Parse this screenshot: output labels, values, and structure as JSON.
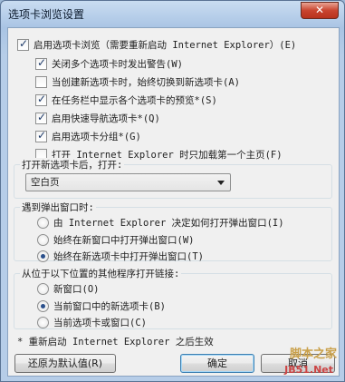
{
  "window": {
    "title": "选项卡浏览设置",
    "close_label": "✕"
  },
  "main_option": {
    "label": "启用选项卡浏览（需要重新启动 Internet Explorer）(E)",
    "checked": true
  },
  "sub_options": [
    {
      "label": "关闭多个选项卡时发出警告(W)",
      "checked": true
    },
    {
      "label": "当创建新选项卡时，始终切换到新选项卡(A)",
      "checked": false
    },
    {
      "label": "在任务栏中显示各个选项卡的预览*(S)",
      "checked": true
    },
    {
      "label": "启用快速导航选项卡*(Q)",
      "checked": true
    },
    {
      "label": "启用选项卡分组*(G)",
      "checked": true
    },
    {
      "label": "打开 Internet Explorer 时只加载第一个主页(F)",
      "checked": false
    }
  ],
  "new_tab": {
    "heading": "打开新选项卡后，打开:",
    "selected": "空白页"
  },
  "popups": {
    "heading": "遇到弹出窗口时:",
    "options": [
      {
        "label": "由 Internet Explorer 决定如何打开弹出窗口(I)",
        "checked": false
      },
      {
        "label": "始终在新窗口中打开弹出窗口(W)",
        "checked": false
      },
      {
        "label": "始终在新选项卡中打开弹出窗口(T)",
        "checked": true
      }
    ]
  },
  "links": {
    "heading": "从位于以下位置的其他程序打开链接:",
    "options": [
      {
        "label": "新窗口(O)",
        "checked": false
      },
      {
        "label": "当前窗口中的新选项卡(B)",
        "checked": true
      },
      {
        "label": "当前选项卡或窗口(C)",
        "checked": false
      }
    ]
  },
  "footnote": "* 重新启动 Internet Explorer 之后生效",
  "buttons": {
    "restore": "还原为默认值(R)",
    "ok": "确定",
    "cancel": "取消"
  },
  "watermark": {
    "line1": "脚本之家",
    "line2": "JB51.Net"
  }
}
